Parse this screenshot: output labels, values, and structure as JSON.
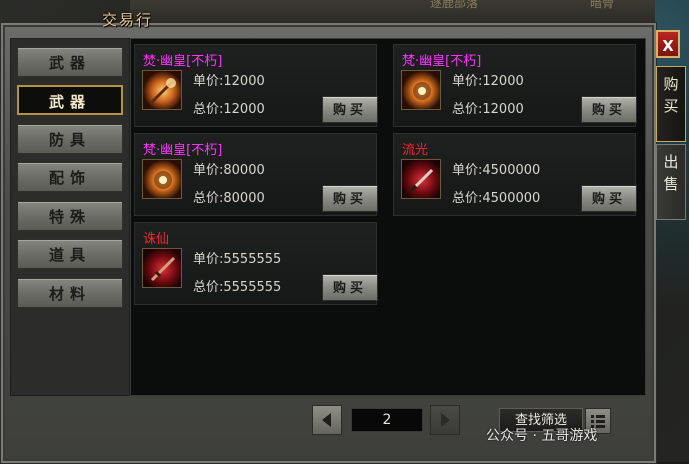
{
  "window": {
    "title": "交易行",
    "close_label": "X"
  },
  "background_labels": [
    "逐鹿部落",
    "暗骨"
  ],
  "side_tabs": [
    {
      "label": "购买",
      "active": true
    },
    {
      "label": "出售",
      "active": false
    }
  ],
  "categories": [
    {
      "label": "武器",
      "active": false
    },
    {
      "label": "武器",
      "active": true
    },
    {
      "label": "防具",
      "active": false
    },
    {
      "label": "配饰",
      "active": false
    },
    {
      "label": "特殊",
      "active": false
    },
    {
      "label": "道具",
      "active": false
    },
    {
      "label": "材料",
      "active": false
    }
  ],
  "price_labels": {
    "unit": "单价:",
    "total": "总价:"
  },
  "items": [
    {
      "name": "焚·幽皇[不朽]",
      "name_color": "#ff33ff",
      "unit_price": "12000",
      "total_price": "12000",
      "buy_label": "购买",
      "icon": "flame-staff-icon"
    },
    {
      "name": "梵·幽皇[不朽]",
      "name_color": "#ff33ff",
      "unit_price": "12000",
      "total_price": "12000",
      "buy_label": "购买",
      "icon": "flame-orb-icon"
    },
    {
      "name": "梵·幽皇[不朽]",
      "name_color": "#ff33ff",
      "unit_price": "80000",
      "total_price": "80000",
      "buy_label": "购买",
      "icon": "flame-orb-icon"
    },
    {
      "name": "流光",
      "name_color": "#ff2424",
      "unit_price": "4500000",
      "total_price": "4500000",
      "buy_label": "购买",
      "icon": "red-blade-icon"
    },
    {
      "name": "诛仙",
      "name_color": "#ff2424",
      "unit_price": "5555555",
      "total_price": "5555555",
      "buy_label": "购买",
      "icon": "red-sword-icon"
    }
  ],
  "pagination": {
    "page": "2"
  },
  "filter_label": "查找筛选",
  "watermark": "公众号 · 五哥游戏"
}
